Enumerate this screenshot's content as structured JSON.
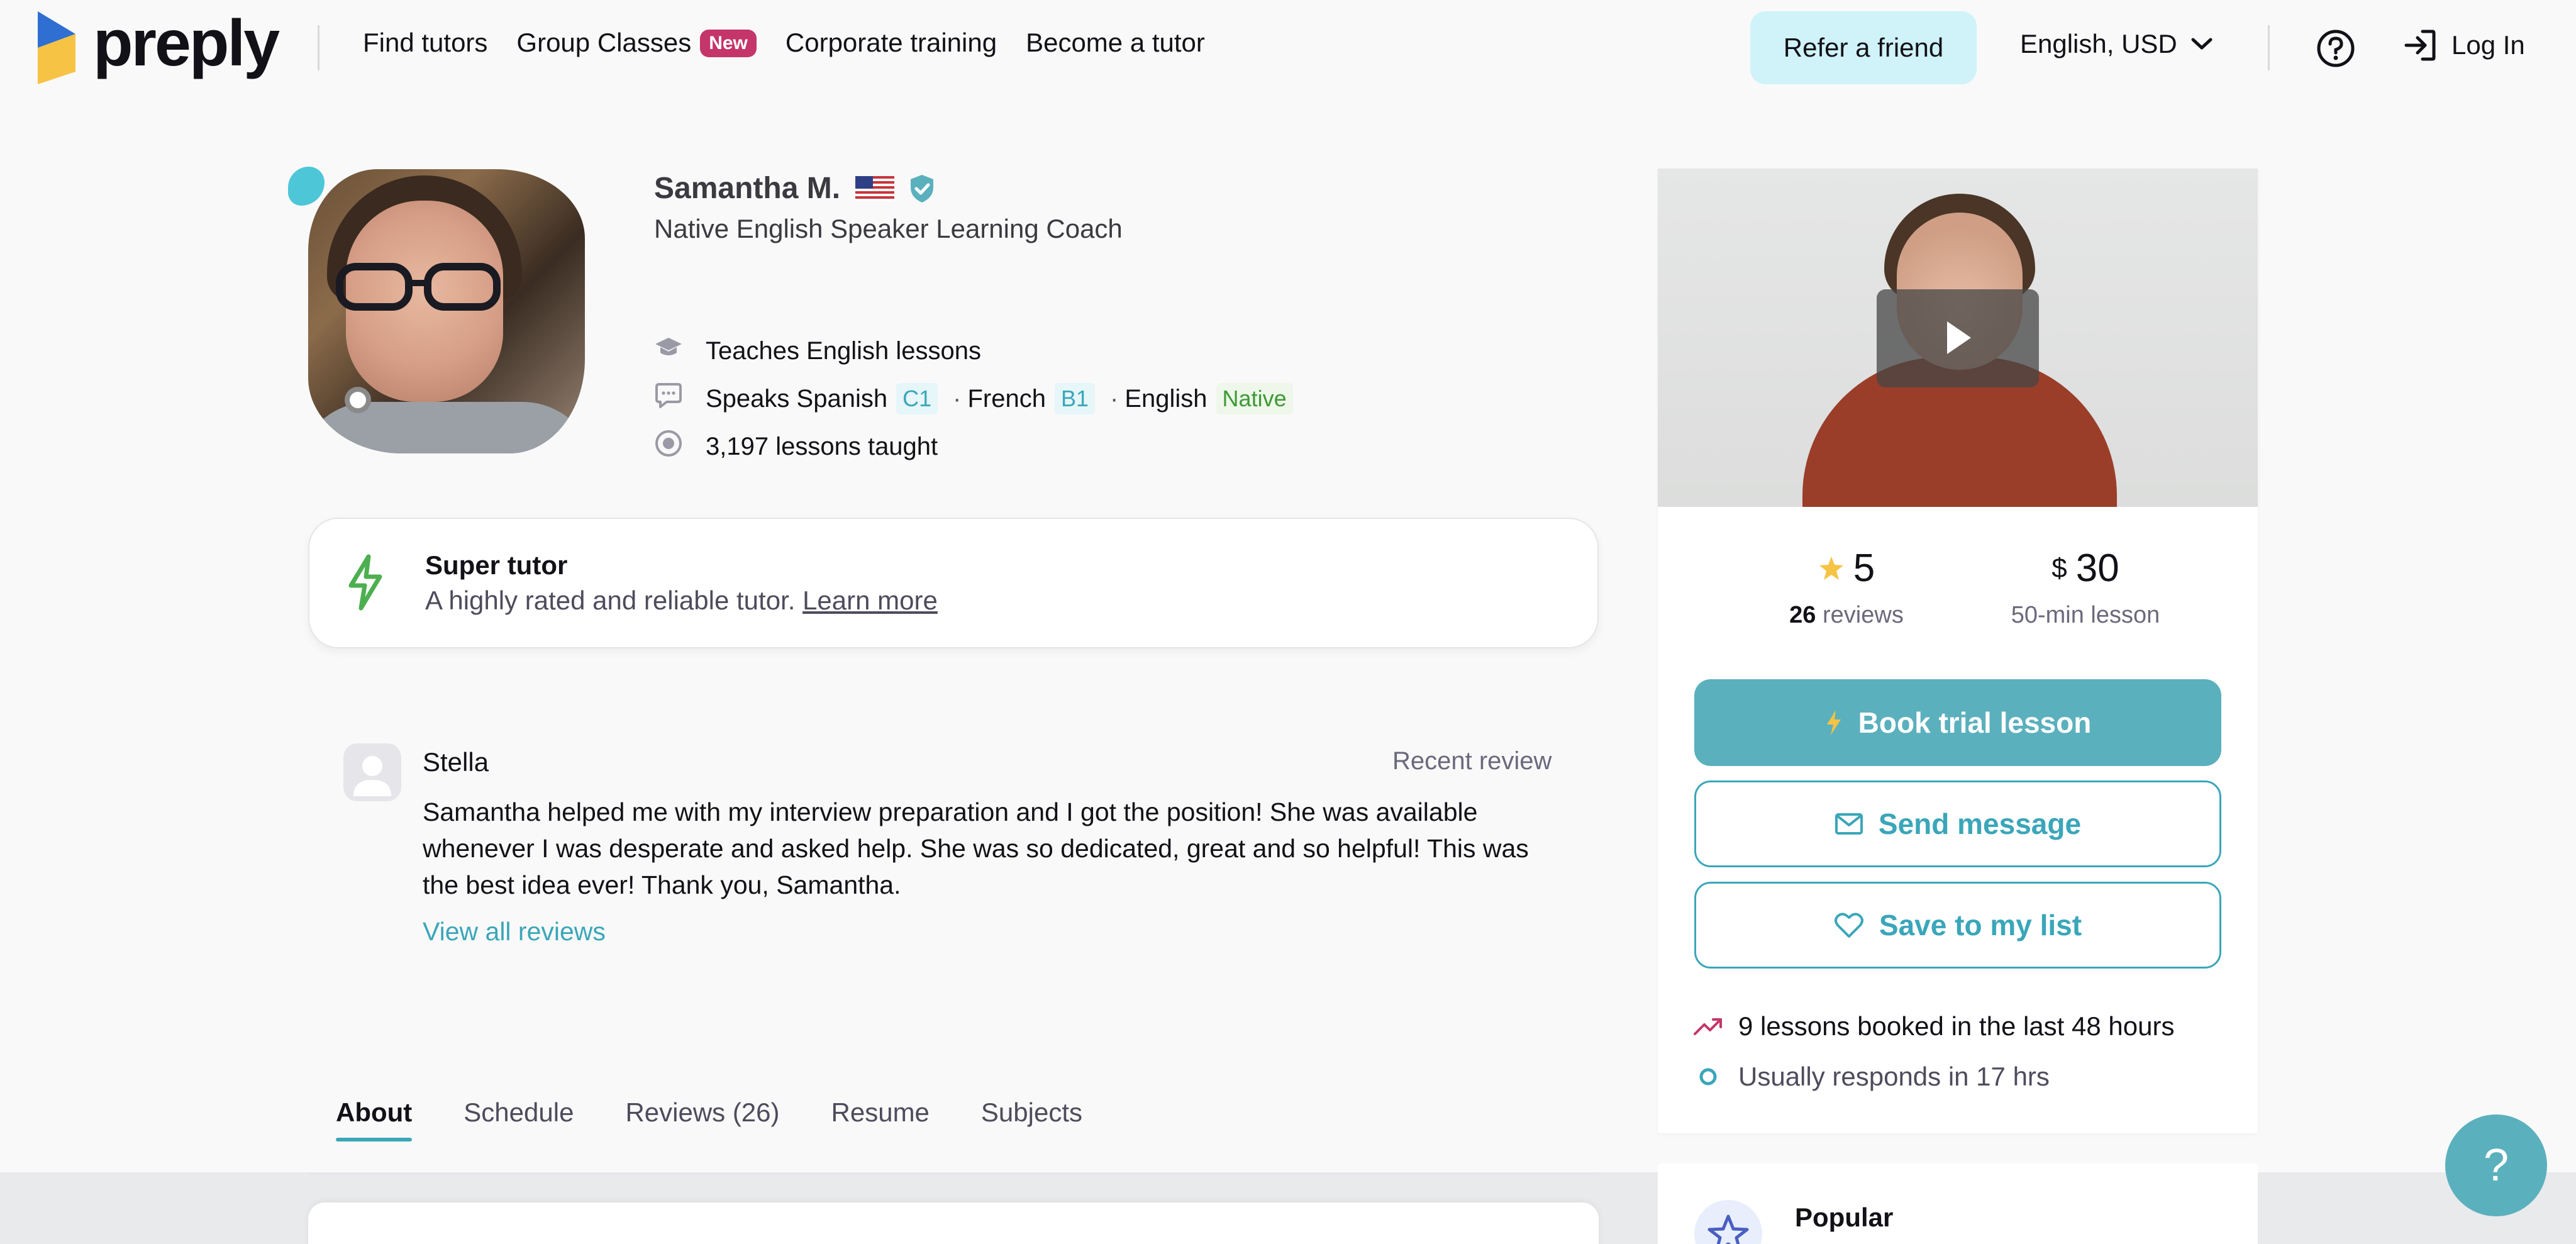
{
  "header": {
    "logo_text": "preply",
    "nav": [
      {
        "label": "Find tutors"
      },
      {
        "label": "Group Classes",
        "badge": "New"
      },
      {
        "label": "Corporate training"
      },
      {
        "label": "Become a tutor"
      }
    ],
    "refer_label": "Refer a friend",
    "language": "English, USD",
    "login_label": "Log In"
  },
  "tutor": {
    "name": "Samantha M.",
    "headline": "Native English Speaker Learning Coach",
    "teaches": "Teaches English lessons",
    "speaks_prefix": "Speaks",
    "languages": [
      {
        "name": "Spanish",
        "level": "C1"
      },
      {
        "name": "French",
        "level": "B1"
      },
      {
        "name": "English",
        "level": "Native"
      }
    ],
    "lessons_taught": "3,197 lessons taught"
  },
  "super_tutor": {
    "title": "Super tutor",
    "description": "A highly rated and reliable tutor.",
    "link": "Learn more"
  },
  "review": {
    "author": "Stella",
    "label": "Recent review",
    "text": "Samantha helped me with my interview preparation and I got the position! She was available whenever I was desperate and asked help. She was so dedicated, great and so helpful! This was the best idea ever! Thank you, Samantha.",
    "view_all": "View all reviews"
  },
  "tabs": [
    {
      "label": "About",
      "active": true
    },
    {
      "label": "Schedule"
    },
    {
      "label": "Reviews (26)"
    },
    {
      "label": "Resume"
    },
    {
      "label": "Subjects"
    }
  ],
  "sidebar": {
    "rating": "5",
    "reviews_count": "26",
    "reviews_label": "reviews",
    "currency": "$",
    "price": "30",
    "price_label": "50-min lesson",
    "book_label": "Book trial lesson",
    "message_label": "Send message",
    "save_label": "Save to my list",
    "booked_info": "9 lessons booked in the last 48 hours",
    "response_info": "Usually responds in 17 hrs",
    "popular_label": "Popular"
  },
  "colors": {
    "accent": "#3aa6b9",
    "primary_button": "#5bb0bd",
    "badge": "#c4356a",
    "refer_bg": "#cff3f9",
    "super_icon": "#4caf50"
  }
}
